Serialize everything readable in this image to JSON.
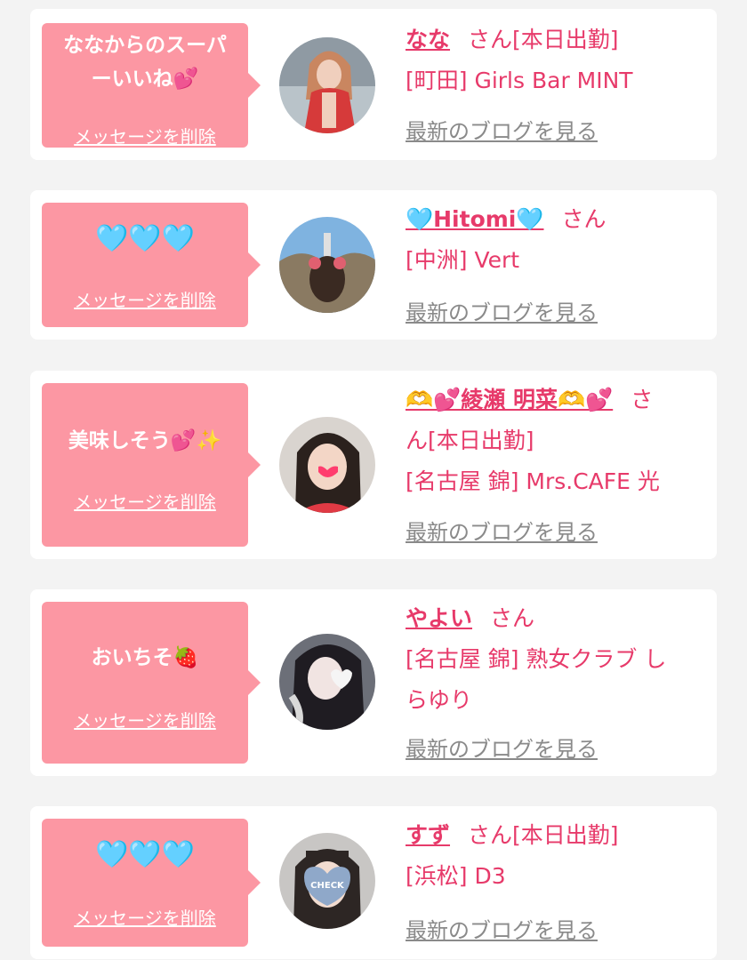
{
  "cards": [
    {
      "message_line1": "ななからのスーパ",
      "message_line2": "ーいいね💕",
      "delete_label": "メッセージを削除",
      "name": "なな",
      "san": "さん",
      "tag": "[本日出勤]",
      "shop": "[町田] Girls Bar MINT",
      "blog_label": "最新のブログを見る"
    },
    {
      "message_line1": "🩵🩵🩵",
      "delete_label": "メッセージを削除",
      "name": "🩵Hitomi🩵",
      "san": "さん",
      "shop": "[中洲] Vert",
      "blog_label": "最新のブログを見る"
    },
    {
      "message_line1": "美味しそう💕✨",
      "delete_label": "メッセージを削除",
      "name": "🫶💕綾瀬 明菜🫶💕",
      "san": "さ",
      "san_cont": "ん[本日出勤]",
      "shop": "[名古屋 錦] Mrs.CAFE 光",
      "blog_label": "最新のブログを見る"
    },
    {
      "message_line1": "おいちそ🍓",
      "delete_label": "メッセージを削除",
      "name": "やよい",
      "san": "さん",
      "shop": "[名古屋 錦] 熟女クラブ し",
      "shop_cont": "らゆり",
      "blog_label": "最新のブログを見る"
    },
    {
      "message_line1": "🩵🩵🩵",
      "delete_label": "メッセージを削除",
      "name": "すず",
      "san": "さん",
      "tag": "[本日出勤]",
      "shop": "[浜松] D3",
      "blog_label": "最新のブログを見る",
      "avatar_text": "CHECK"
    }
  ],
  "colors": {
    "bubble": "#fc97a3",
    "accent": "#e73a6a",
    "link_gray": "#8a8a8a",
    "background": "#f3f3f3"
  }
}
